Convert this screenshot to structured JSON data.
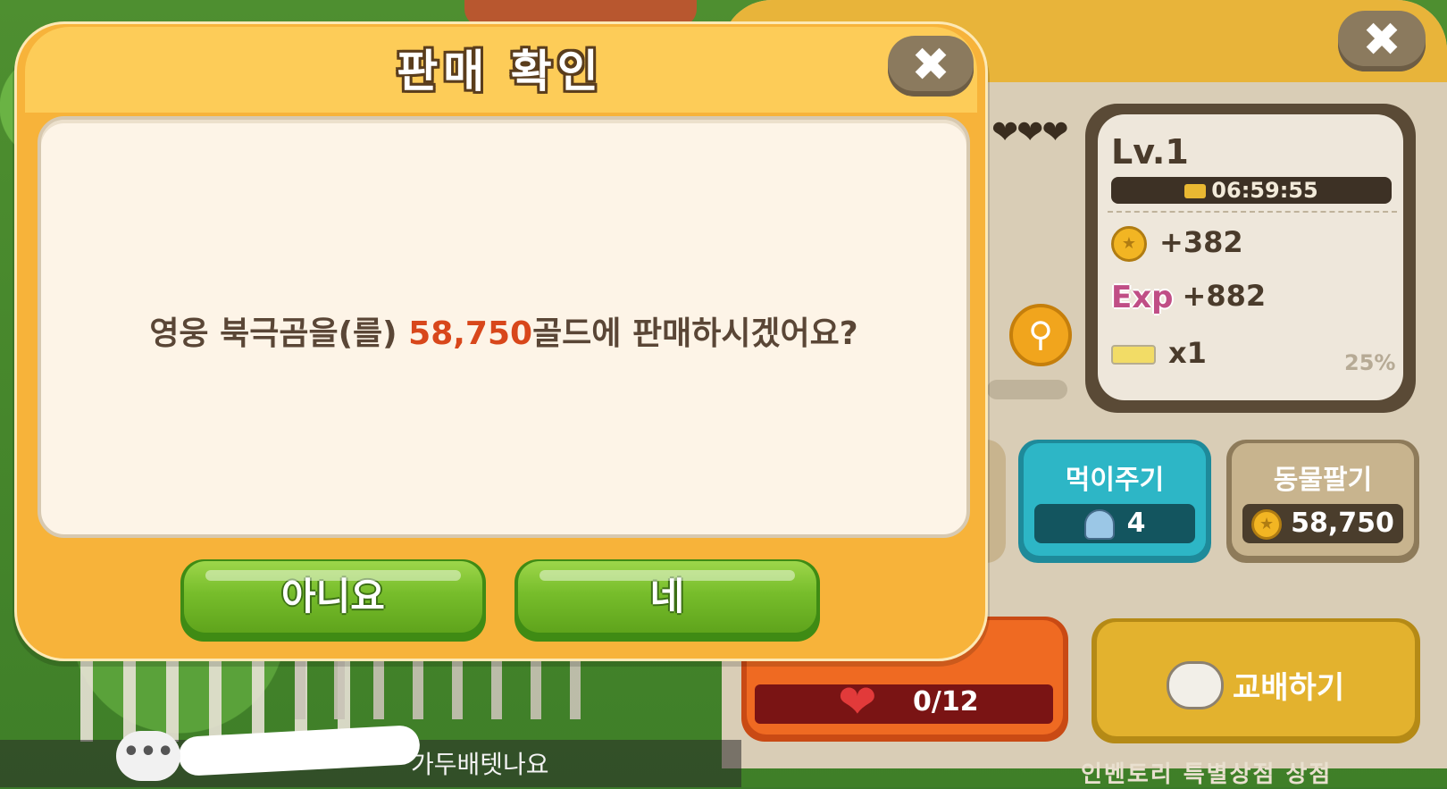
{
  "dialog": {
    "title": "판매 확인",
    "close_glyph": "✖",
    "message_prefix": "영웅 북극곰을(를) ",
    "message_price": "58,750",
    "message_suffix": "골드에 판매하시겠어요?",
    "no_label": "아니요",
    "yes_label": "네"
  },
  "panel": {
    "close_glyph": "✖",
    "hearts": "❤❤❤",
    "search_glyph": "⚲",
    "level": "Lv.1",
    "timer": "06:59:55",
    "gold_gain": "+382",
    "exp_label": "Exp",
    "exp_gain": "+882",
    "item_count": "x1",
    "item_percent": "25%",
    "feed_label": "먹이주기",
    "feed_count": "4",
    "sell_label": "동물팔기",
    "sell_price": "58,750",
    "heart_count": "0/12",
    "breed_label": "교배하기",
    "bottom_tabs": "인벤토리  특별상점  상점"
  },
  "chat": {
    "icon_glyph": "•••",
    "message": "가두배텟나요"
  },
  "colors": {
    "dialog_bg": "#f7b33a",
    "price_accent": "#d8471b",
    "button_green": "#77bd2b"
  },
  "icons": [
    "close-icon",
    "magnify-icon",
    "coin-icon",
    "gold-bar-icon",
    "butter-icon",
    "bell-icon",
    "heart-icon",
    "sheep-icon",
    "chat-icon"
  ]
}
